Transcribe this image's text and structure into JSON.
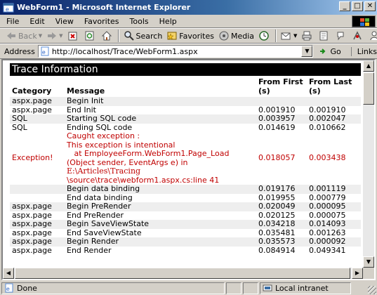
{
  "window": {
    "title": "WebForm1 - Microsoft Internet Explorer",
    "buttons": [
      "_",
      "□",
      "✕"
    ]
  },
  "menu": [
    "File",
    "Edit",
    "View",
    "Favorites",
    "Tools",
    "Help"
  ],
  "toolbar": {
    "back": "Back",
    "forward": "",
    "search": "Search",
    "favorites": "Favorites",
    "media": "Media"
  },
  "address": {
    "label": "Address",
    "url": "http://localhost/Trace/WebForm1.aspx",
    "go": "Go",
    "links": "Links"
  },
  "trace": {
    "header": "Trace Information",
    "columns": [
      "Category",
      "Message",
      "From First (s)",
      "From Last (s)"
    ],
    "rows": [
      {
        "cat": "aspx.page",
        "msg": "Begin Init",
        "ff": "",
        "fl": ""
      },
      {
        "cat": "aspx.page",
        "msg": "End Init",
        "ff": "0.001910",
        "fl": "0.001910"
      },
      {
        "cat": "SQL",
        "msg": "Starting SQL code",
        "ff": "0.003957",
        "fl": "0.002047"
      },
      {
        "cat": "SQL",
        "msg": "Ending SQL code",
        "ff": "0.014619",
        "fl": "0.010662"
      }
    ],
    "exception": {
      "cat": "Exception!",
      "lines": [
        "Caught exception :",
        "This exception is intentional",
        "   at EmployeeForm.WebForm1.Page_Load",
        "(Object sender, EventArgs e) in"
      ],
      "path1": "E:\\Articles\\Tracing",
      "path2": "\\source\\trace\\webform1.aspx.cs:line 41",
      "ff": "0.018057",
      "fl": "0.003438"
    },
    "rows2": [
      {
        "cat": "",
        "msg": "Begin data binding",
        "ff": "0.019176",
        "fl": "0.001119"
      },
      {
        "cat": "",
        "msg": "End data binding",
        "ff": "0.019955",
        "fl": "0.000779"
      },
      {
        "cat": "aspx.page",
        "msg": "Begin PreRender",
        "ff": "0.020049",
        "fl": "0.000095"
      },
      {
        "cat": "aspx.page",
        "msg": "End PreRender",
        "ff": "0.020125",
        "fl": "0.000075"
      },
      {
        "cat": "aspx.page",
        "msg": "Begin SaveViewState",
        "ff": "0.034218",
        "fl": "0.014093"
      },
      {
        "cat": "aspx.page",
        "msg": "End SaveViewState",
        "ff": "0.035481",
        "fl": "0.001263"
      },
      {
        "cat": "aspx.page",
        "msg": "Begin Render",
        "ff": "0.035573",
        "fl": "0.000092"
      },
      {
        "cat": "aspx.page",
        "msg": "End Render",
        "ff": "0.084914",
        "fl": "0.049341"
      }
    ]
  },
  "status": {
    "text": "Done",
    "zone": "Local intranet"
  },
  "colors": {
    "exception": "#c00000",
    "titlebar": "#0a246a",
    "alt_row": "#eeeeee"
  }
}
